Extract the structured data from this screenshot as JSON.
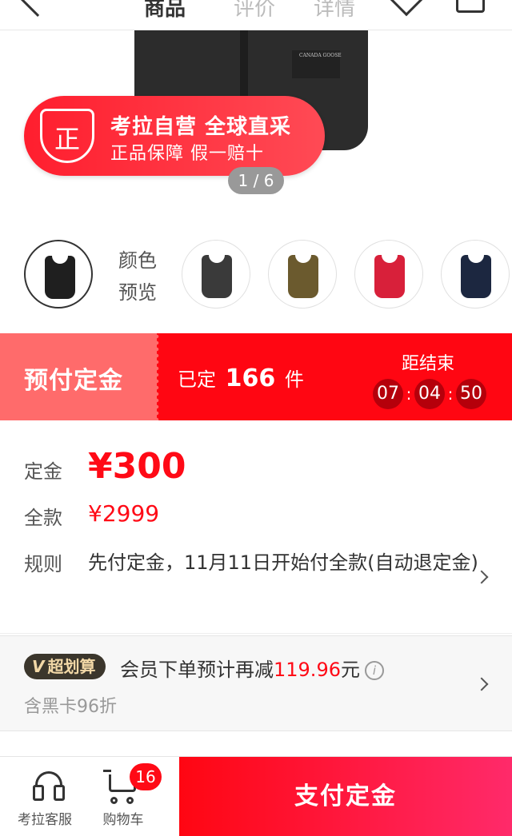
{
  "nav": {
    "tabs": [
      "商品",
      "评价",
      "详情"
    ]
  },
  "hero": {
    "vest_brand": "CANADA GOOSE",
    "badge_icon_text": "正",
    "badge_line1": "考拉自营 全球直采",
    "badge_line2": "正品保障 假一赔十",
    "pager": "1 / 6"
  },
  "colors": {
    "label": "颜色预览",
    "swatches": [
      {
        "name": "black",
        "color": "#1f1f1f"
      },
      {
        "name": "graphite",
        "color": "#3a3a3a"
      },
      {
        "name": "olive",
        "color": "#6b5a2e"
      },
      {
        "name": "red",
        "color": "#d8203a"
      },
      {
        "name": "navy",
        "color": "#1c2740"
      }
    ]
  },
  "presale": {
    "label": "预付定金",
    "sold_prefix": "已定",
    "sold_count": "166",
    "sold_unit": "件",
    "countdown_label": "距结束",
    "hours": "07",
    "minutes": "04",
    "seconds": "50"
  },
  "price": {
    "deposit_label": "定金",
    "deposit_value": "¥300",
    "full_label": "全款",
    "full_value": "¥2999",
    "rule_label": "规则",
    "rule_text": "先付定金，11月11日开始付全款(自动退定金)"
  },
  "member": {
    "tag": "超划算",
    "tag_icon": "V",
    "text_prefix": "会员下单预计再减",
    "amount": "119.96",
    "text_suffix": "元",
    "info_icon": "i",
    "sub": "含黑卡96折"
  },
  "bottom": {
    "service_label": "考拉客服",
    "cart_label": "购物车",
    "cart_count": "16",
    "pay_label": "支付定金"
  }
}
